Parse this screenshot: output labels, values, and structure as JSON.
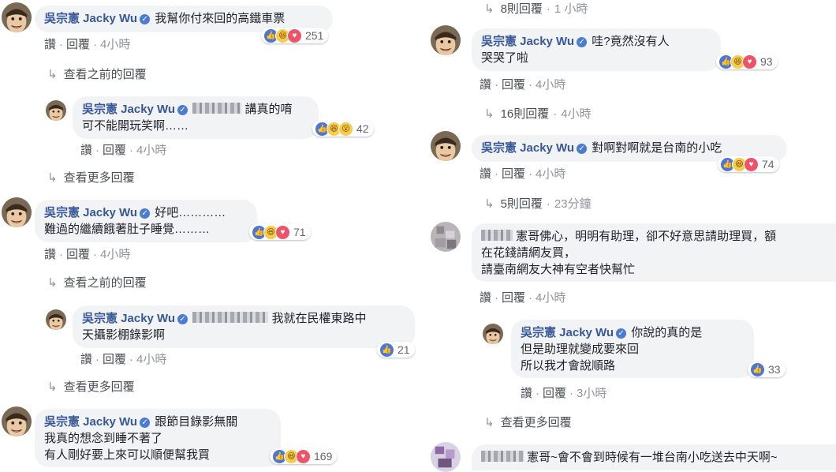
{
  "common": {
    "author": "吳宗憲 Jacky Wu",
    "like": "讚",
    "reply": "回覆",
    "dot": "·",
    "view_prev": "查看之前的回覆",
    "view_more": "查看更多回覆",
    "arrow": "↳"
  },
  "left": {
    "c1": {
      "text": "我幫你付來回的高鐵車票",
      "count": "251",
      "time": "4小時"
    },
    "r1": {
      "line1": "講真的唷",
      "line2": "可不能開玩笑啊……",
      "count": "42",
      "time": "4小時"
    },
    "c2": {
      "line1": "好吧…………",
      "line2": "難過的繼續餓著肚子睡覺………",
      "count": "71",
      "time": "4小時"
    },
    "r2": {
      "line1": "我就在民權東路中",
      "line2": "天攝影棚錄影啊",
      "count": "21",
      "time": "4小時"
    },
    "c3": {
      "line1": "跟節目錄影無關",
      "line2": "我真的想念到睡不著了",
      "line3": "有人剛好要上來可以順便幫我買",
      "count": "169"
    }
  },
  "right": {
    "top_replies": "8則回覆",
    "top_time": "1 小時",
    "c1": {
      "line1": "哇?竟然沒有人",
      "line2": "哭哭了啦",
      "count": "93",
      "time": "4小時",
      "replies": "16則回覆",
      "replies_time": "4小時"
    },
    "c2": {
      "text": "對啊對啊就是台南的小吃",
      "count": "74",
      "time": "4小時",
      "replies": "5則回覆",
      "replies_time": "23分鐘"
    },
    "c3": {
      "line1": "憲哥佛心，明明有助理，卻不好意思請助理買，額",
      "line2": "在花錢請網友買，",
      "line3": "請臺南網友大神有空者快幫忙",
      "time": "4小時"
    },
    "r3": {
      "line1": "你說的真的是",
      "line2": "但是助理就變成要來回",
      "line3": "所以我才會說順路",
      "count": "33",
      "time": "3小時"
    },
    "c4": {
      "text": "憲哥~會不會到時候有一堆台南小吃送去中天啊~"
    }
  },
  "colors": {
    "name": "#365899",
    "bubble": "#f2f3f5",
    "like": "#4a76e0",
    "love": "#f25268",
    "haha": "#f7cc4a"
  }
}
